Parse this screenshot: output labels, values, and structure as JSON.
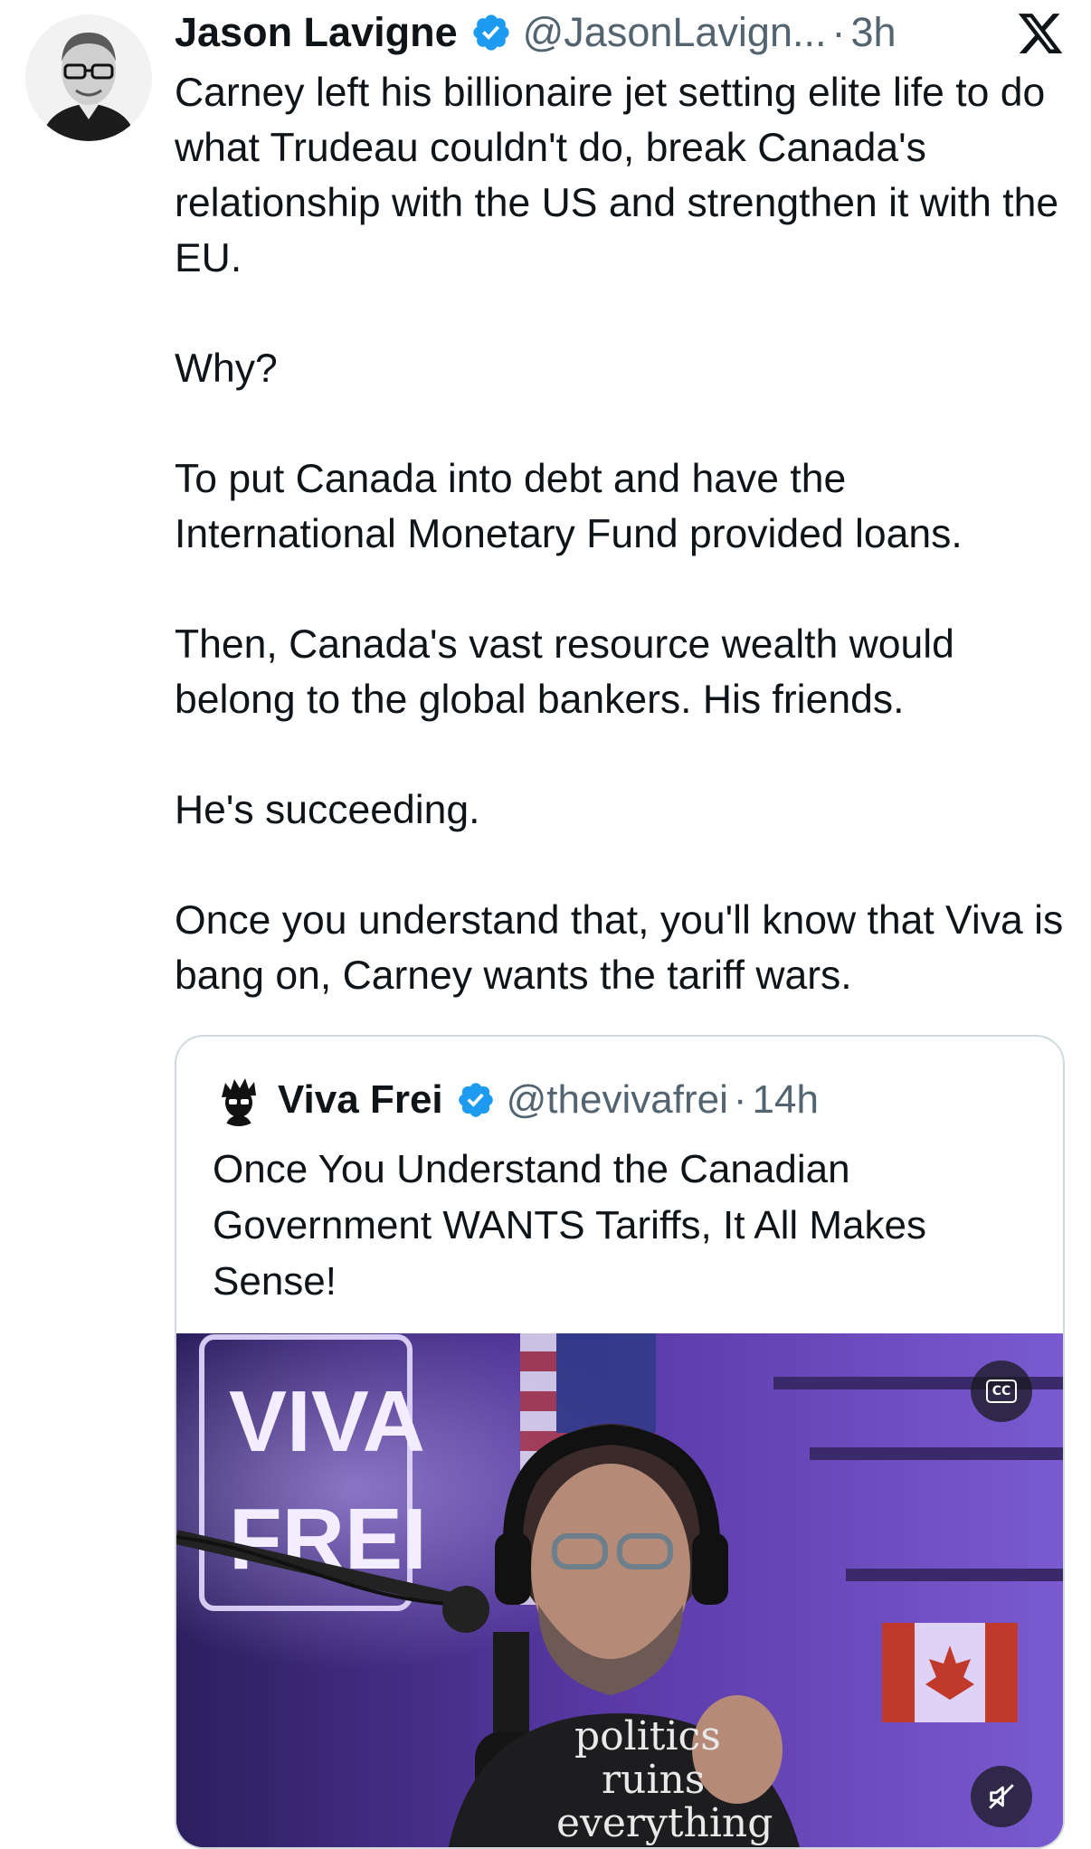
{
  "tweet": {
    "author_name": "Jason Lavigne",
    "handle": "@JasonLavign...",
    "separator": "·",
    "time": "3h",
    "text": "Carney left his billionaire jet setting elite life to do what Trudeau couldn't do, break Canada's relationship with the US and strengthen it with the EU.\n\nWhy?\n\nTo put Canada into debt and have the International Monetary Fund provided loans.\n\nThen, Canada's vast resource wealth would belong to the global bankers. His friends.\n\nHe's succeeding.\n\nOnce you understand that, you'll know that Viva is bang on, Carney wants the tariff wars."
  },
  "quote": {
    "author_name": "Viva Frei",
    "handle": "@thevivafrei",
    "separator": "·",
    "time": "14h",
    "text": "Once You Understand the Canadian Government WANTS Tariffs, It All Makes Sense!",
    "video": {
      "neon_sign": "VIVA FREI",
      "shirt_text": [
        "politics",
        "ruins",
        "everything"
      ],
      "cc_label": "CC"
    }
  },
  "icons": {
    "verified": "verified-badge-icon",
    "x_logo": "x-logo-icon",
    "mute": "muted-speaker-icon",
    "captions": "closed-captions-icon"
  },
  "colors": {
    "text": "#0f1419",
    "secondary": "#536471",
    "verified_blue": "#1d9bf0",
    "border": "#cfd9de"
  }
}
